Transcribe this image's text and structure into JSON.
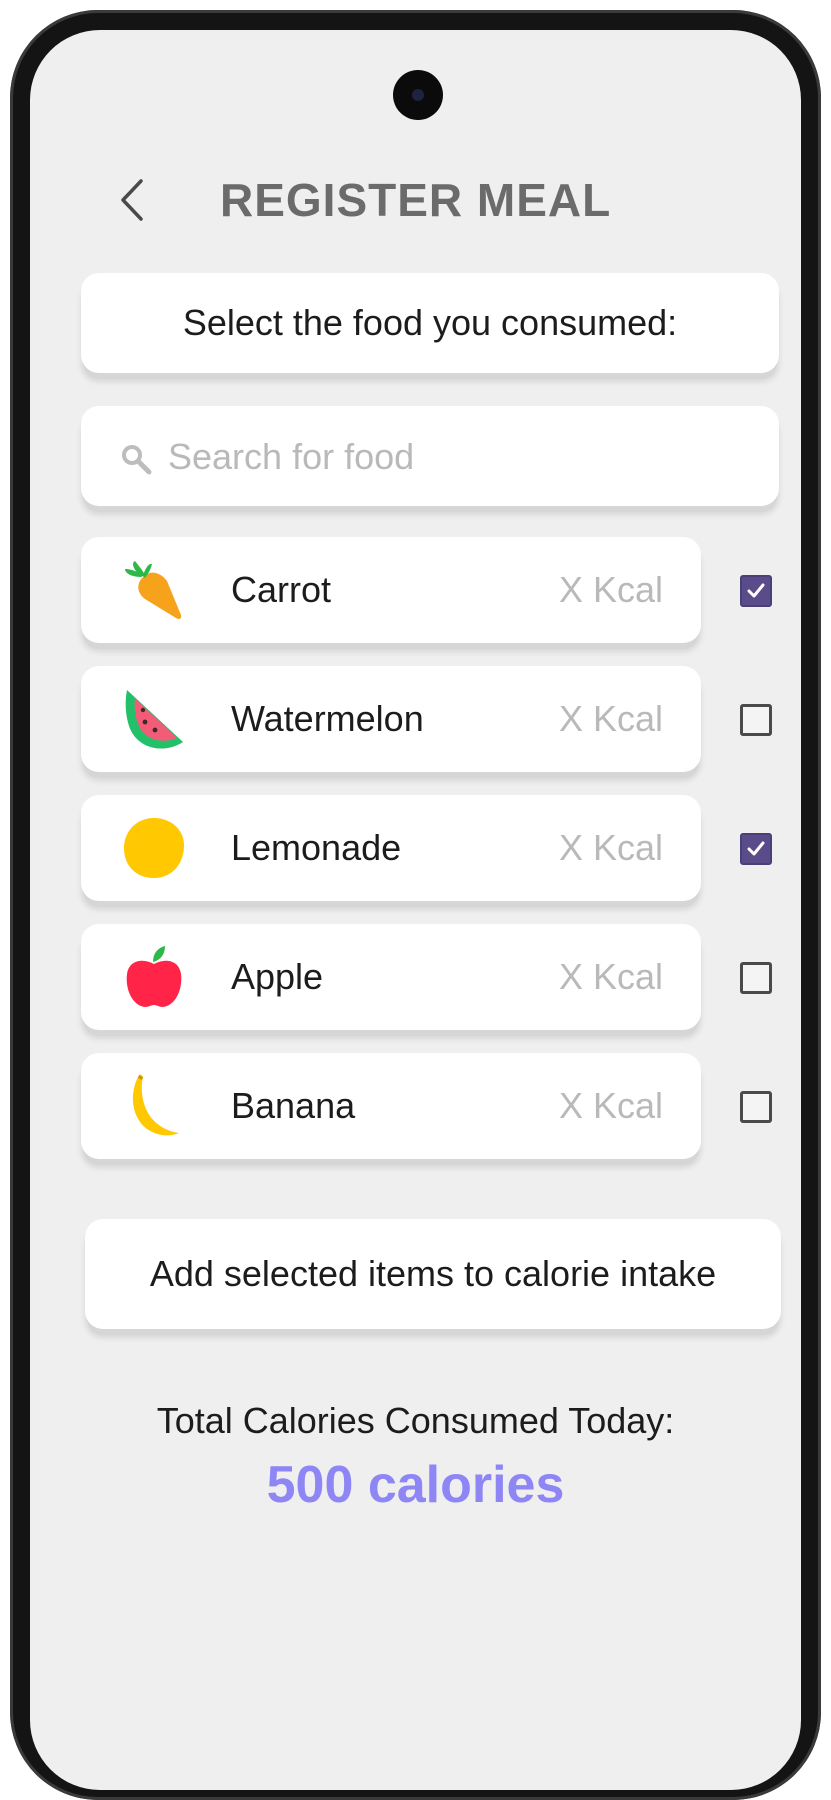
{
  "header": {
    "title": "REGISTER MEAL",
    "back_icon": "chevron-left-icon"
  },
  "instruction": {
    "text": "Select the food you consumed:"
  },
  "search": {
    "placeholder": "Search for food",
    "value": "",
    "icon": "search-icon"
  },
  "foods": [
    {
      "name": "Carrot",
      "kcal": "X Kcal",
      "checked": true,
      "icon": "carrot-icon"
    },
    {
      "name": "Watermelon",
      "kcal": "X Kcal",
      "checked": false,
      "icon": "watermelon-icon"
    },
    {
      "name": "Lemonade",
      "kcal": "X Kcal",
      "checked": true,
      "icon": "lemon-icon"
    },
    {
      "name": "Apple",
      "kcal": "X Kcal",
      "checked": false,
      "icon": "apple-icon"
    },
    {
      "name": "Banana",
      "kcal": "X Kcal",
      "checked": false,
      "icon": "banana-icon"
    }
  ],
  "actions": {
    "add_label": "Add selected items to calorie intake"
  },
  "summary": {
    "label": "Total Calories Consumed Today:",
    "value": "500 calories"
  },
  "colors": {
    "accent": "#8f86f6",
    "checkbox_checked": "#5a4c8a",
    "background": "#efefef"
  }
}
